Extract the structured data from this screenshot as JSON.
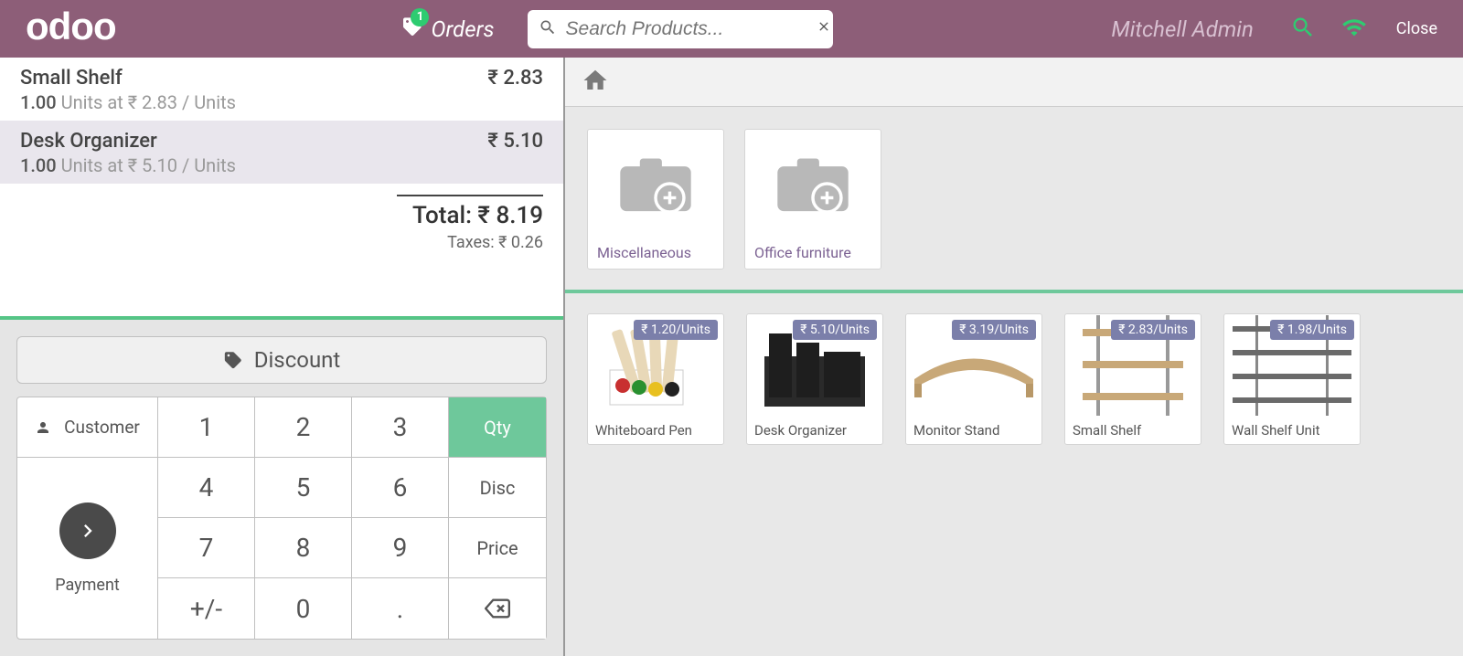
{
  "header": {
    "logo": "odoo",
    "orders_label": "Orders",
    "orders_badge": "1",
    "search_placeholder": "Search Products...",
    "username": "Mitchell Admin",
    "close_label": "Close"
  },
  "order": {
    "lines": [
      {
        "name": "Small Shelf",
        "qty": "1.00",
        "qty_label": "Units at ₹ 2.83 / Units",
        "price": "₹ 2.83",
        "selected": false
      },
      {
        "name": "Desk Organizer",
        "qty": "1.00",
        "qty_label": "Units at ₹ 5.10 / Units",
        "price": "₹ 5.10",
        "selected": true
      }
    ],
    "total_label": "Total: ",
    "total_value": "₹ 8.19",
    "taxes_label": "Taxes: ",
    "taxes_value": "₹ 0.26"
  },
  "actionpad": {
    "discount_label": "Discount",
    "customer_label": "Customer",
    "payment_label": "Payment"
  },
  "numpad": {
    "keys": [
      "1",
      "2",
      "3",
      "Qty",
      "4",
      "5",
      "6",
      "Disc",
      "7",
      "8",
      "9",
      "Price",
      "+/-",
      "0",
      ".",
      "⌫"
    ],
    "active_index": 3
  },
  "categories": [
    {
      "label": "Miscellaneous"
    },
    {
      "label": "Office furniture"
    }
  ],
  "products": [
    {
      "name": "Whiteboard Pen",
      "price": "₹ 1.20/Units"
    },
    {
      "name": "Desk Organizer",
      "price": "₹ 5.10/Units"
    },
    {
      "name": "Monitor Stand",
      "price": "₹ 3.19/Units"
    },
    {
      "name": "Small Shelf",
      "price": "₹ 2.83/Units"
    },
    {
      "name": "Wall Shelf Unit",
      "price": "₹ 1.98/Units"
    }
  ]
}
